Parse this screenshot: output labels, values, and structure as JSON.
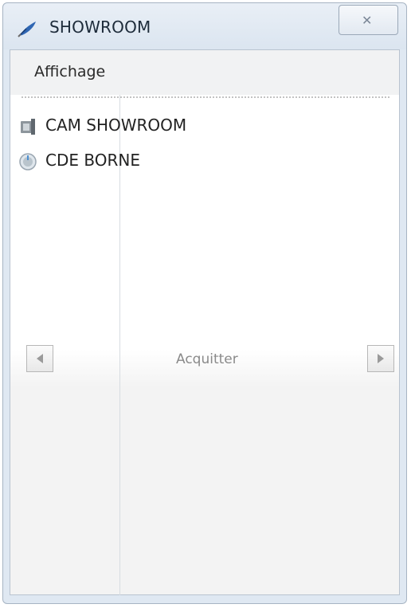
{
  "window": {
    "title": "SHOWROOM",
    "icon": "feather-pen-icon",
    "close_glyph": "✕"
  },
  "menu": {
    "items": [
      {
        "label": "Affichage"
      }
    ]
  },
  "list": {
    "items": [
      {
        "label": "CAM SHOWROOM",
        "icon": "camera-icon"
      },
      {
        "label": "CDE BORNE",
        "icon": "power-knob-icon"
      }
    ]
  },
  "footer": {
    "prev_icon": "left-arrow-icon",
    "next_icon": "right-arrow-icon",
    "acknowledge_label": "Acquitter"
  }
}
